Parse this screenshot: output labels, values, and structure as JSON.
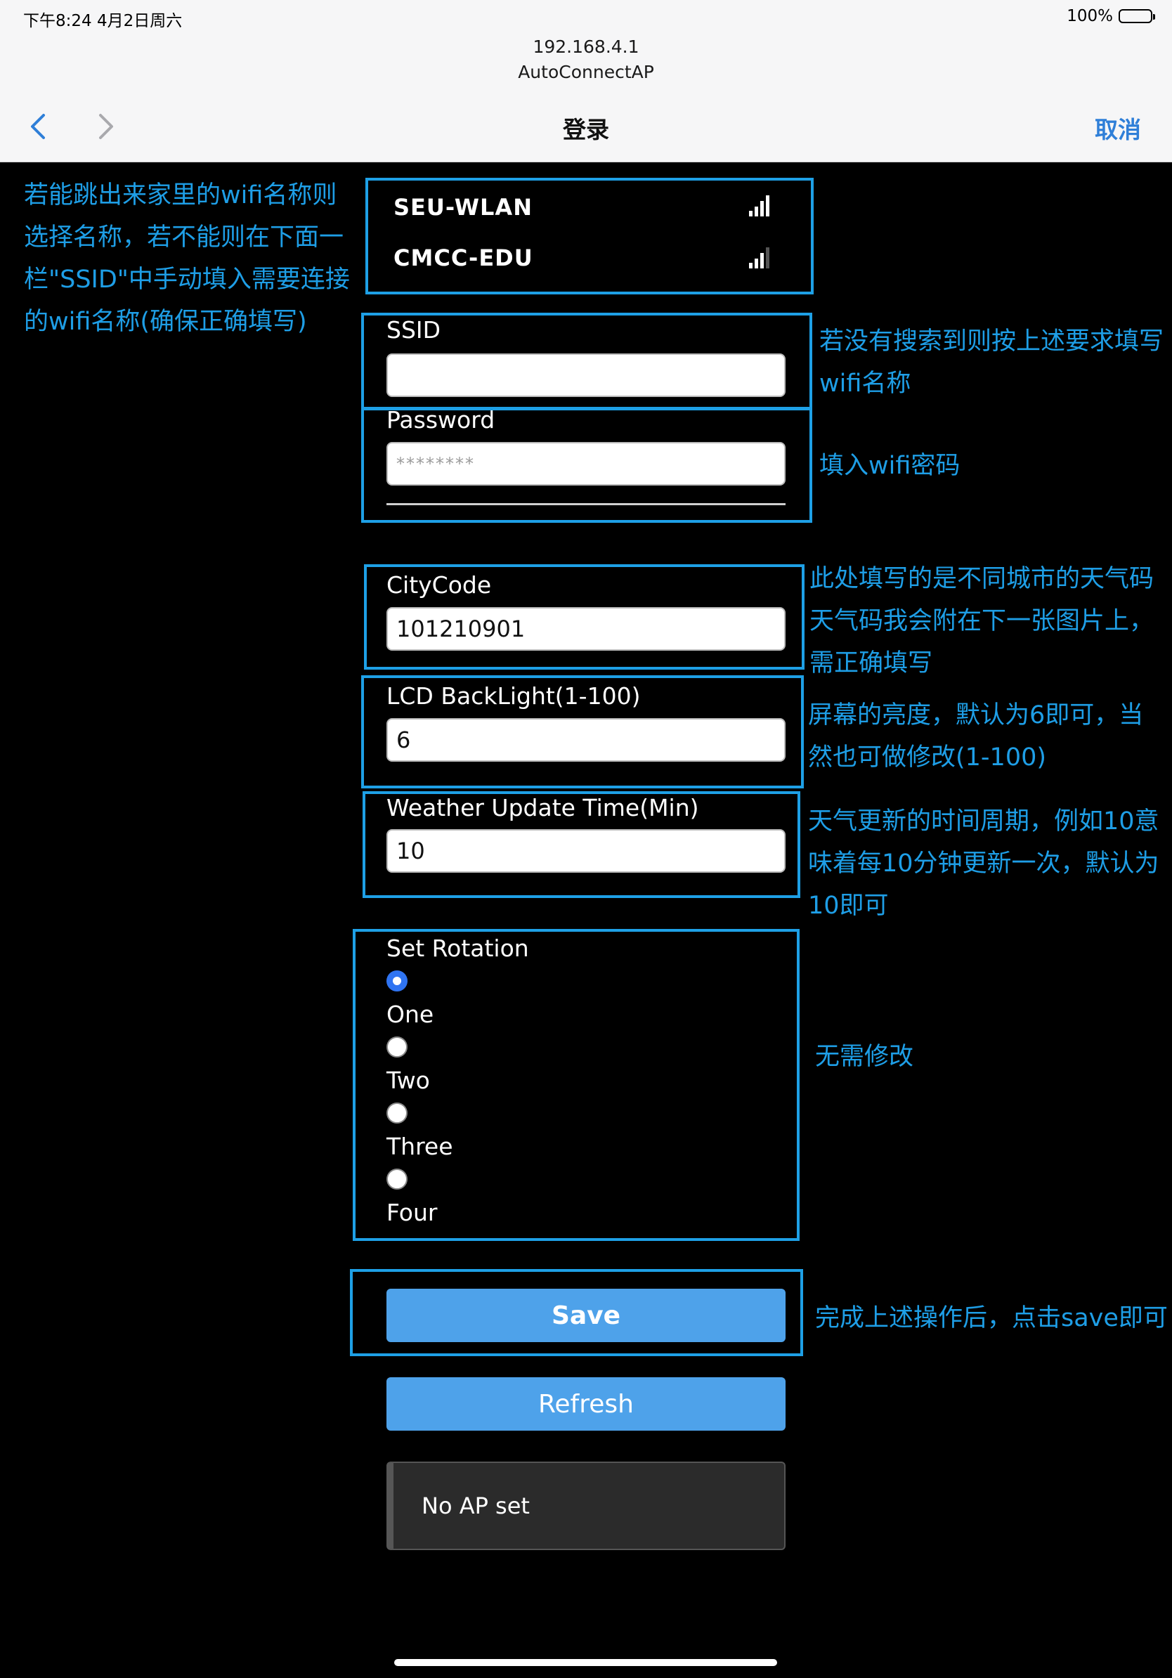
{
  "status_bar": {
    "time_date": "下午8:24   4月2日周六",
    "battery": "100%"
  },
  "browser": {
    "url": "192.168.4.1",
    "page_title": "AutoConnectAP",
    "nav_title": "登录",
    "cancel_label": "取消"
  },
  "networks": [
    {
      "name": "SEU-WLAN",
      "signal_bars": 4
    },
    {
      "name": "CMCC-EDU",
      "signal_bars": 3
    }
  ],
  "form": {
    "ssid_label": "SSID",
    "ssid_value": "",
    "password_label": "Password",
    "password_placeholder": "********",
    "citycode_label": "CityCode",
    "citycode_value": "101210901",
    "backlight_label": "LCD BackLight(1-100)",
    "backlight_value": "6",
    "update_label": "Weather Update Time(Min)",
    "update_value": "10",
    "rotation_label": "Set Rotation",
    "rotation_options": [
      "One",
      "Two",
      "Three",
      "Four"
    ],
    "rotation_selected": "One",
    "save_label": "Save",
    "refresh_label": "Refresh",
    "status_text": "No AP set"
  },
  "annotations": {
    "network_select": [
      "若能跳出来家里的wifi名称则",
      "选择名称，若不能则在下面一",
      "栏\"SSID\"中手动填入需要连接",
      "的wifi名称(确保正确填写)"
    ],
    "ssid": [
      "若没有搜索到则按上述要求填写",
      "wifi名称"
    ],
    "password": [
      "填入wifi密码"
    ],
    "citycode": [
      "此处填写的是不同城市的天气码",
      "天气码我会附在下一张图片上，",
      "需正确填写"
    ],
    "backlight": [
      "屏幕的亮度，默认为6即可，当",
      "然也可做修改(1-100)"
    ],
    "update": [
      "天气更新的时间周期，例如10意",
      "味着每10分钟更新一次，默认为",
      "10即可"
    ],
    "rotation": [
      "无需修改"
    ],
    "save": [
      "完成上述操作后，点击save即可"
    ]
  },
  "colors": {
    "annotation": "#1ea0e6",
    "button": "#4ea2ea",
    "background": "#000000",
    "nav_accent": "#2f7fd8"
  }
}
